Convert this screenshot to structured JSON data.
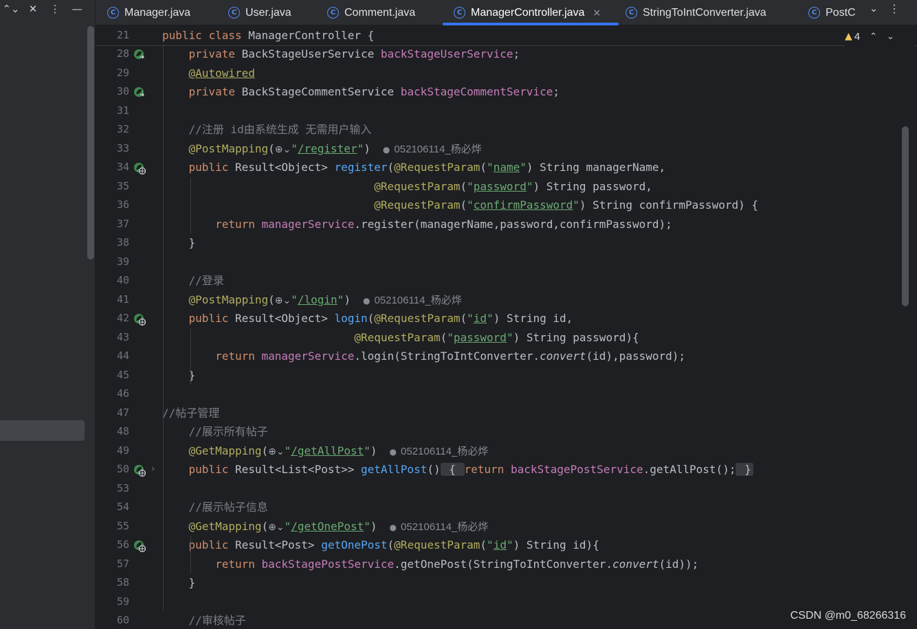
{
  "left_toolbar": {
    "icons": [
      "expand-collapse-icon",
      "collapse-all-icon",
      "more-options-icon",
      "minimize-icon"
    ]
  },
  "tabs": [
    {
      "label": "Manager.java",
      "active": false
    },
    {
      "label": "User.java",
      "active": false
    },
    {
      "label": "Comment.java",
      "active": false
    },
    {
      "label": "ManagerController.java",
      "active": true
    },
    {
      "label": "StringToIntConverter.java",
      "active": false
    },
    {
      "label": "PostC",
      "active": false
    }
  ],
  "tab_icon_glyph": "C",
  "close_glyph": "×",
  "tabbar": {
    "chevron": "⌄",
    "more": "⋮"
  },
  "inspections": {
    "warning_count": "4",
    "up": "⌃",
    "down": "⌄"
  },
  "hint_author": "052106114_杨必烨",
  "lines": [
    {
      "n": "21",
      "tokens": [
        [
          "k",
          "public "
        ],
        [
          "k",
          "class "
        ],
        [
          "g",
          "ManagerController {"
        ]
      ]
    },
    {
      "n": "28",
      "gutter": "bean",
      "tokens": [
        [
          "g",
          "    "
        ],
        [
          "k",
          "private "
        ],
        [
          "g",
          "BackStageUserService "
        ],
        [
          "f",
          "backStageUserService"
        ],
        [
          "g",
          ";"
        ]
      ]
    },
    {
      "n": "29",
      "tokens": [
        [
          "g",
          "    "
        ],
        [
          "a au",
          "@Autowired"
        ]
      ]
    },
    {
      "n": "30",
      "gutter": "bean",
      "tokens": [
        [
          "g",
          "    "
        ],
        [
          "k",
          "private "
        ],
        [
          "g",
          "BackStageCommentService "
        ],
        [
          "f",
          "backStageCommentService"
        ],
        [
          "g",
          ";"
        ]
      ]
    },
    {
      "n": "31",
      "tokens": []
    },
    {
      "n": "32",
      "tokens": [
        [
          "g",
          "    "
        ],
        [
          "c",
          "//注册 id由系统生成 无需用户输入"
        ]
      ]
    },
    {
      "n": "33",
      "tokens": [
        [
          "g",
          "    "
        ],
        [
          "a",
          "@PostMapping"
        ],
        [
          "g",
          "("
        ],
        [
          "globe",
          ""
        ],
        [
          "s",
          "\""
        ],
        [
          "su",
          "/register"
        ],
        [
          "s",
          "\""
        ],
        [
          "g",
          ")"
        ]
      ],
      "hint": true
    },
    {
      "n": "34",
      "gutter": "web",
      "tokens": [
        [
          "g",
          "    "
        ],
        [
          "k",
          "public "
        ],
        [
          "g",
          "Result<Object> "
        ],
        [
          "m",
          "register"
        ],
        [
          "g",
          "("
        ],
        [
          "a",
          "@RequestParam"
        ],
        [
          "g",
          "("
        ],
        [
          "s",
          "\""
        ],
        [
          "su",
          "name"
        ],
        [
          "s",
          "\""
        ],
        [
          "g",
          ") String managerName,"
        ]
      ]
    },
    {
      "n": "35",
      "tokens": [
        [
          "g",
          "                                "
        ],
        [
          "a",
          "@RequestParam"
        ],
        [
          "g",
          "("
        ],
        [
          "s",
          "\""
        ],
        [
          "su",
          "password"
        ],
        [
          "s",
          "\""
        ],
        [
          "g",
          ") String password,"
        ]
      ]
    },
    {
      "n": "36",
      "tokens": [
        [
          "g",
          "                                "
        ],
        [
          "a",
          "@RequestParam"
        ],
        [
          "g",
          "("
        ],
        [
          "s",
          "\""
        ],
        [
          "su",
          "confirmPassword"
        ],
        [
          "s",
          "\""
        ],
        [
          "g",
          ") String confirmPassword) {"
        ]
      ]
    },
    {
      "n": "37",
      "tokens": [
        [
          "g",
          "        "
        ],
        [
          "k",
          "return "
        ],
        [
          "f",
          "managerService"
        ],
        [
          "g",
          ".register(managerName,password,confirmPassword);"
        ]
      ]
    },
    {
      "n": "38",
      "tokens": [
        [
          "g",
          "    }"
        ]
      ]
    },
    {
      "n": "39",
      "tokens": []
    },
    {
      "n": "40",
      "tokens": [
        [
          "g",
          "    "
        ],
        [
          "c",
          "//登录"
        ]
      ]
    },
    {
      "n": "41",
      "tokens": [
        [
          "g",
          "    "
        ],
        [
          "a",
          "@PostMapping"
        ],
        [
          "g",
          "("
        ],
        [
          "globe",
          ""
        ],
        [
          "s",
          "\""
        ],
        [
          "su",
          "/login"
        ],
        [
          "s",
          "\""
        ],
        [
          "g",
          ")"
        ]
      ],
      "hint": true
    },
    {
      "n": "42",
      "gutter": "web",
      "tokens": [
        [
          "g",
          "    "
        ],
        [
          "k",
          "public "
        ],
        [
          "g",
          "Result<Object> "
        ],
        [
          "m",
          "login"
        ],
        [
          "g",
          "("
        ],
        [
          "a",
          "@RequestParam"
        ],
        [
          "g",
          "("
        ],
        [
          "s",
          "\""
        ],
        [
          "su",
          "id"
        ],
        [
          "s",
          "\""
        ],
        [
          "g",
          ") String id,"
        ]
      ]
    },
    {
      "n": "43",
      "tokens": [
        [
          "g",
          "                             "
        ],
        [
          "a",
          "@RequestParam"
        ],
        [
          "g",
          "("
        ],
        [
          "s",
          "\""
        ],
        [
          "su",
          "password"
        ],
        [
          "s",
          "\""
        ],
        [
          "g",
          ") String password){"
        ]
      ]
    },
    {
      "n": "44",
      "tokens": [
        [
          "g",
          "        "
        ],
        [
          "k",
          "return "
        ],
        [
          "f",
          "managerService"
        ],
        [
          "g",
          ".login(StringToIntConverter."
        ],
        [
          "i",
          "convert"
        ],
        [
          "g",
          "(id),password);"
        ]
      ]
    },
    {
      "n": "45",
      "tokens": [
        [
          "g",
          "    }"
        ]
      ]
    },
    {
      "n": "46",
      "tokens": []
    },
    {
      "n": "47",
      "tokens": [
        [
          "c",
          "//帖子管理"
        ]
      ]
    },
    {
      "n": "48",
      "tokens": [
        [
          "g",
          "    "
        ],
        [
          "c",
          "//展示所有帖子"
        ]
      ]
    },
    {
      "n": "49",
      "tokens": [
        [
          "g",
          "    "
        ],
        [
          "a",
          "@GetMapping"
        ],
        [
          "g",
          "("
        ],
        [
          "globe",
          ""
        ],
        [
          "s",
          "\""
        ],
        [
          "su",
          "/getAllPost"
        ],
        [
          "s",
          "\""
        ],
        [
          "g",
          ")"
        ]
      ],
      "hint": true
    },
    {
      "n": "50",
      "gutter": "web",
      "fold": "›",
      "tokens": [
        [
          "g",
          "    "
        ],
        [
          "k",
          "public "
        ],
        [
          "g",
          "Result<List<Post>> "
        ],
        [
          "m",
          "getAllPost"
        ],
        [
          "g",
          "()"
        ],
        [
          "foldbox",
          " { "
        ],
        [
          "k",
          "return "
        ],
        [
          "f",
          "backStagePostService"
        ],
        [
          "g",
          ".getAllPost();"
        ],
        [
          "foldbox",
          " }"
        ]
      ]
    },
    {
      "n": "53",
      "tokens": []
    },
    {
      "n": "54",
      "tokens": [
        [
          "g",
          "    "
        ],
        [
          "c",
          "//展示帖子信息"
        ]
      ]
    },
    {
      "n": "55",
      "tokens": [
        [
          "g",
          "    "
        ],
        [
          "a",
          "@GetMapping"
        ],
        [
          "g",
          "("
        ],
        [
          "globe",
          ""
        ],
        [
          "s",
          "\""
        ],
        [
          "su",
          "/getOnePost"
        ],
        [
          "s",
          "\""
        ],
        [
          "g",
          ")"
        ]
      ],
      "hint": true
    },
    {
      "n": "56",
      "gutter": "web",
      "tokens": [
        [
          "g",
          "    "
        ],
        [
          "k",
          "public "
        ],
        [
          "g",
          "Result<Post> "
        ],
        [
          "m",
          "getOnePost"
        ],
        [
          "g",
          "("
        ],
        [
          "a",
          "@RequestParam"
        ],
        [
          "g",
          "("
        ],
        [
          "s",
          "\""
        ],
        [
          "su",
          "id"
        ],
        [
          "s",
          "\""
        ],
        [
          "g",
          ") String id){"
        ]
      ]
    },
    {
      "n": "57",
      "tokens": [
        [
          "g",
          "        "
        ],
        [
          "k",
          "return "
        ],
        [
          "f",
          "backStagePostService"
        ],
        [
          "g",
          ".getOnePost(StringToIntConverter."
        ],
        [
          "i",
          "convert"
        ],
        [
          "g",
          "(id));"
        ]
      ]
    },
    {
      "n": "58",
      "tokens": [
        [
          "g",
          "    }"
        ]
      ]
    },
    {
      "n": "59",
      "tokens": []
    },
    {
      "n": "60",
      "tokens": [
        [
          "g",
          "    "
        ],
        [
          "c",
          "//审核帖子"
        ]
      ]
    }
  ],
  "watermark": "CSDN @m0_68266316"
}
